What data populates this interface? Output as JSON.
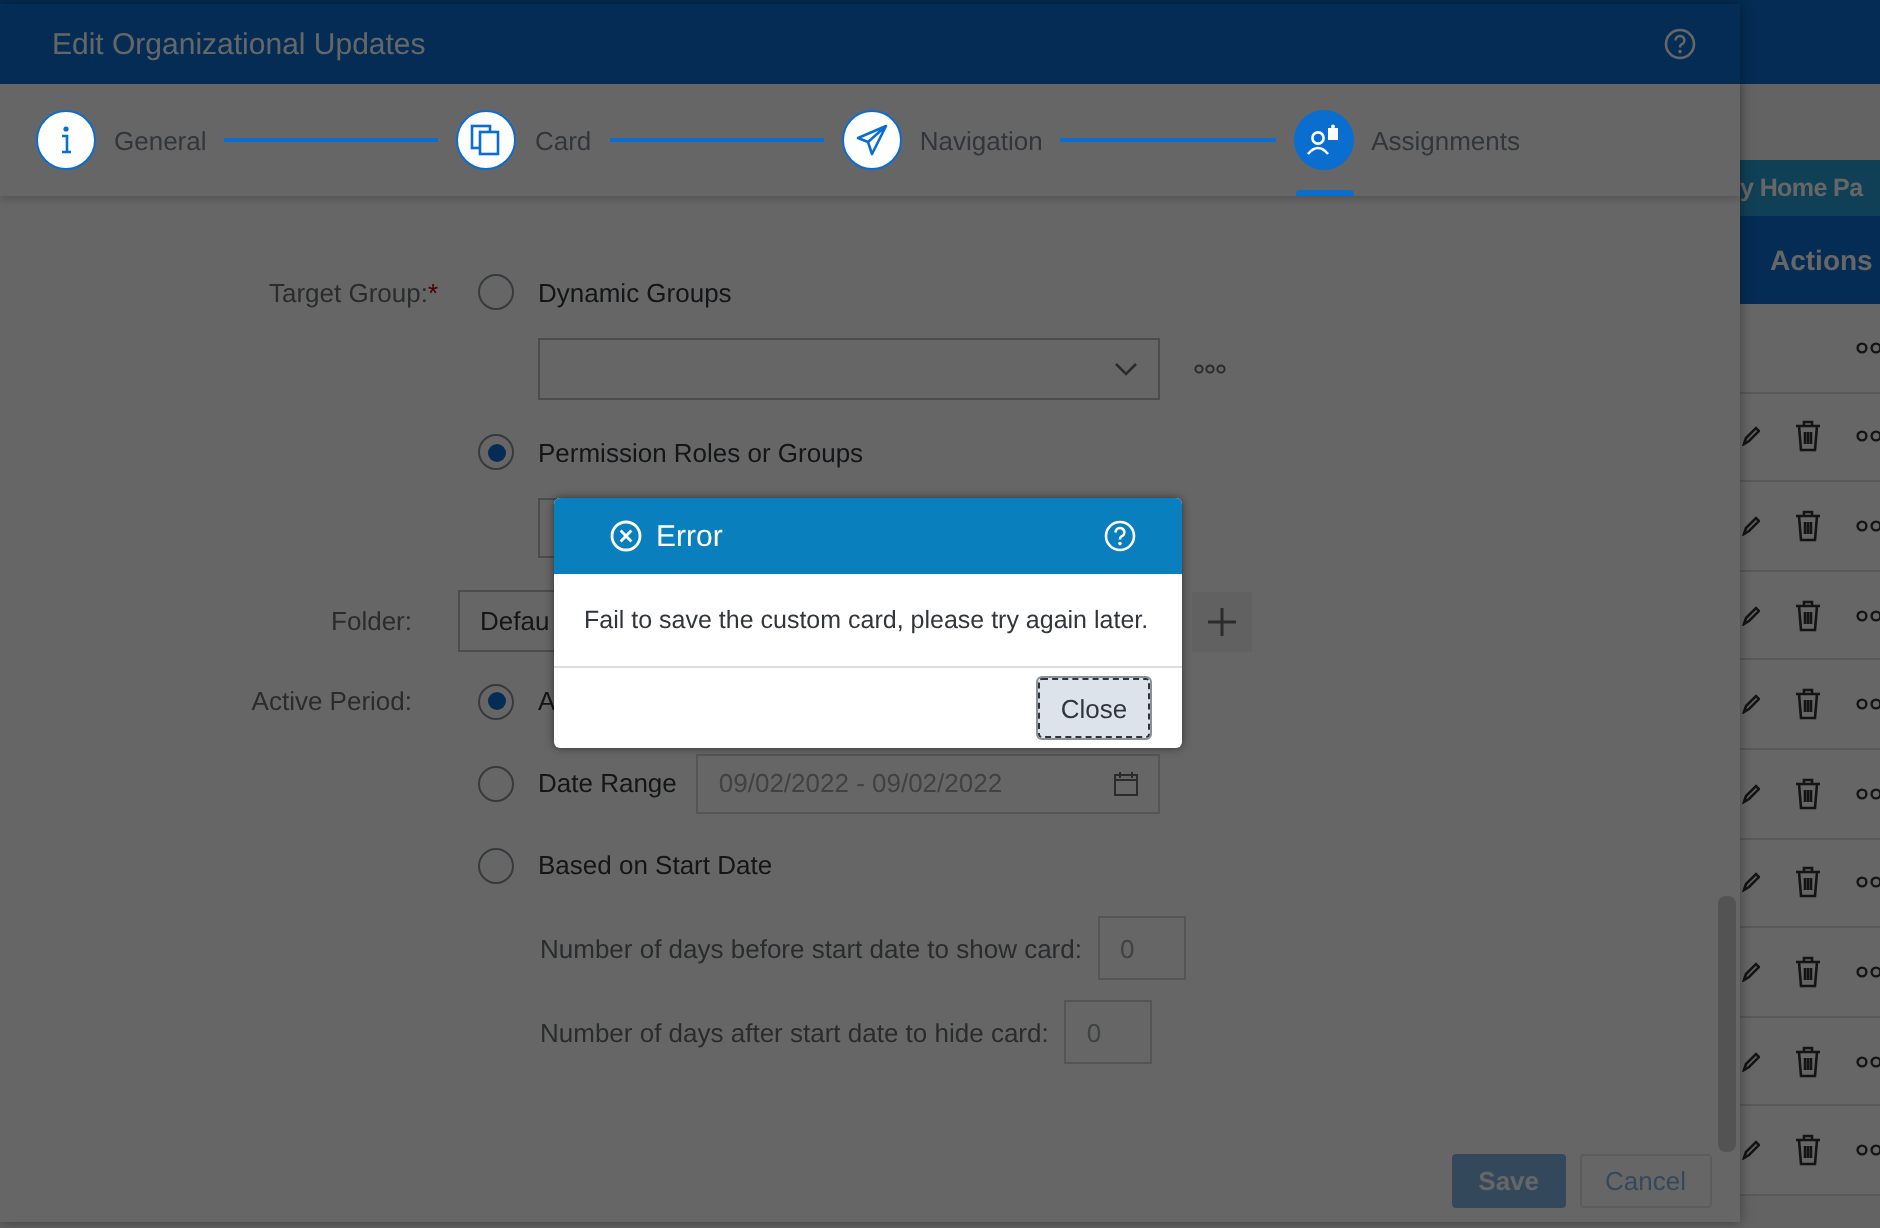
{
  "background_page": {
    "tab_label": "y Home Pa",
    "column_header": "Actions",
    "rows": [
      {
        "kind": "more"
      },
      {
        "kind": "full"
      },
      {
        "kind": "full"
      },
      {
        "kind": "full"
      },
      {
        "kind": "full"
      },
      {
        "kind": "full"
      },
      {
        "kind": "full"
      },
      {
        "kind": "full"
      },
      {
        "kind": "full"
      },
      {
        "kind": "full"
      }
    ]
  },
  "dialog": {
    "title": "Edit Organizational Updates",
    "steps": [
      {
        "label": "General",
        "kind": "info",
        "selected": false
      },
      {
        "label": "Card",
        "kind": "copy",
        "selected": false
      },
      {
        "label": "Navigation",
        "kind": "send",
        "selected": false
      },
      {
        "label": "Assignments",
        "kind": "people",
        "selected": true
      }
    ],
    "form": {
      "target_group": {
        "label": "Target Group:",
        "required_mark": "*",
        "options": [
          {
            "label": "Dynamic Groups",
            "selected": false,
            "kind": "dropdown"
          },
          {
            "label": "Permission Roles or Groups",
            "selected": true,
            "kind": "input"
          }
        ]
      },
      "folder": {
        "label": "Folder:",
        "value": "Defau"
      },
      "active_period": {
        "label": "Active Period:",
        "options": [
          {
            "label": "A",
            "selected": true,
            "kind": "plain"
          },
          {
            "label": "Date Range",
            "selected": false,
            "kind": "date_range",
            "placeholder": "09/02/2022 - 09/02/2022"
          },
          {
            "label": "Based on Start Date",
            "selected": false,
            "kind": "start_date",
            "fields": [
              {
                "label": "Number of days before start date to show card:",
                "placeholder": "0"
              },
              {
                "label": "Number of days after start date to hide card:",
                "placeholder": "0"
              }
            ]
          }
        ]
      }
    },
    "footer_buttons": [
      {
        "label": "Save",
        "kind": "primary",
        "disabled": true
      },
      {
        "label": "Cancel",
        "kind": "secondary",
        "disabled": true
      }
    ]
  },
  "error_dialog": {
    "title": "Error",
    "message": "Fail to save the custom card, please try again later.",
    "button": "Close"
  }
}
